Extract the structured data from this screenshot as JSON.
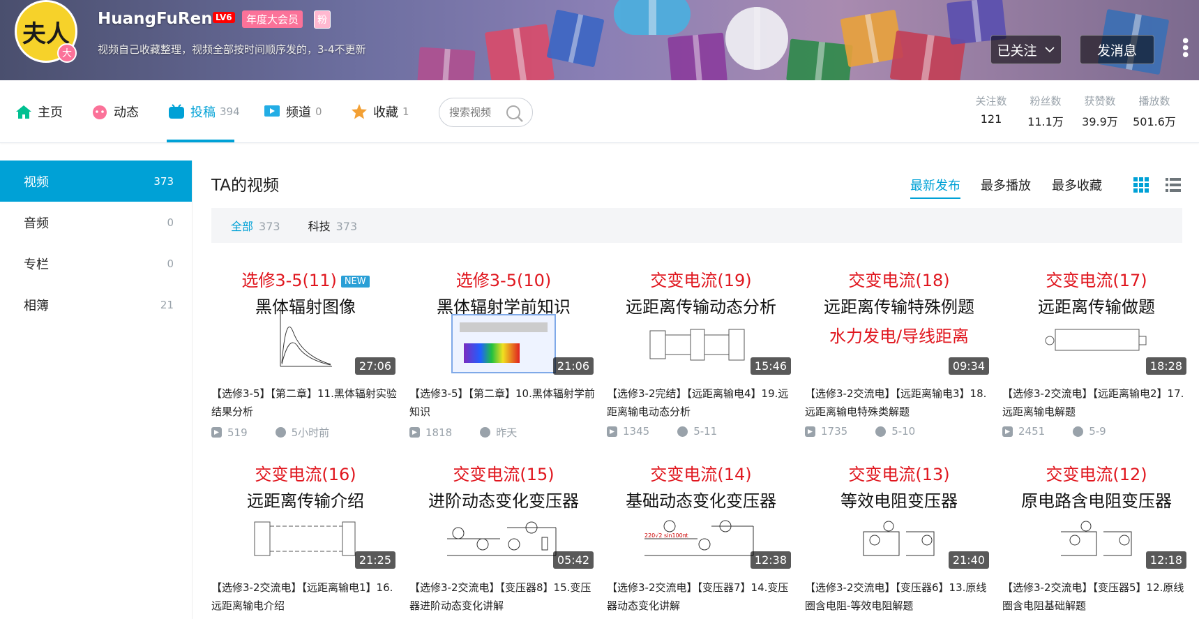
{
  "user": {
    "avatar_text": "夫人",
    "avatar_badge": "大",
    "name": "HuangFuRen",
    "level": "LV6",
    "vip": "年度大会员",
    "fan_badge": "粉",
    "sign": "视频自己收藏整理，视频全部按时间顺序发的，3-4不更新",
    "follow_btn": "已关注",
    "msg_btn": "发消息"
  },
  "nav": {
    "home": "主页",
    "dynamic": "动态",
    "tougao": "投稿",
    "tougao_count": "394",
    "channel": "频道",
    "channel_count": "0",
    "fav": "收藏",
    "fav_count": "1",
    "search_placeholder": "搜索视频"
  },
  "stats": [
    {
      "label": "关注数",
      "value": "121"
    },
    {
      "label": "粉丝数",
      "value": "11.1万"
    },
    {
      "label": "获赞数",
      "value": "39.9万"
    },
    {
      "label": "播放数",
      "value": "501.6万"
    }
  ],
  "sidebar": [
    {
      "label": "视频",
      "count": "373"
    },
    {
      "label": "音频",
      "count": "0"
    },
    {
      "label": "专栏",
      "count": "0"
    },
    {
      "label": "相簿",
      "count": "21"
    }
  ],
  "main": {
    "title": "TA的视频",
    "sort_new": "最新发布",
    "sort_play": "最多播放",
    "sort_fav": "最多收藏",
    "filter_all": "全部",
    "filter_all_count": "373",
    "filter_tech": "科技",
    "filter_tech_count": "373"
  },
  "videos": [
    {
      "t1": "选修3-5(11)",
      "new": "NEW",
      "t2": "黑体辐射图像",
      "t3": "",
      "dur": "27:06",
      "title": "【选修3-5】【第二章】11.黑体辐射实验结果分析",
      "plays": "519",
      "time": "5小时前"
    },
    {
      "t1": "选修3-5(10)",
      "new": "",
      "t2": "黑体辐射学前知识",
      "t3": "",
      "dur": "21:06",
      "title": "【选修3-5】【第二章】10.黑体辐射学前知识",
      "plays": "1818",
      "time": "昨天"
    },
    {
      "t1": "交变电流(19)",
      "new": "",
      "t2": "远距离传输动态分析",
      "t3": "",
      "dur": "15:46",
      "title": "【选修3-2完结】【远距离输电4】19.远距离输电动态分析",
      "plays": "1345",
      "time": "5-11"
    },
    {
      "t1": "交变电流(18)",
      "new": "",
      "t2": "远距离传输特殊例题",
      "t3": "水力发电/导线距离",
      "dur": "09:34",
      "title": "【选修3-2交流电】【远距离输电3】18.远距离输电特殊类解题",
      "plays": "1735",
      "time": "5-10"
    },
    {
      "t1": "交变电流(17)",
      "new": "",
      "t2": "远距离传输做题",
      "t3": "",
      "dur": "18:28",
      "title": "【选修3-2交流电】【远距离输电2】17.远距离输电解题",
      "plays": "2451",
      "time": "5-9"
    },
    {
      "t1": "交变电流(16)",
      "new": "",
      "t2": "远距离传输介绍",
      "t3": "",
      "dur": "21:25",
      "title": "【选修3-2交流电】【远距离输电1】16.远距离输电介绍",
      "plays": "",
      "time": ""
    },
    {
      "t1": "交变电流(15)",
      "new": "",
      "t2": "进阶动态变化变压器",
      "t3": "",
      "dur": "05:42",
      "title": "【选修3-2交流电】【变压器8】15.变压器进阶动态变化讲解",
      "plays": "",
      "time": ""
    },
    {
      "t1": "交变电流(14)",
      "new": "",
      "t2": "基础动态变化变压器",
      "t3": "",
      "dur": "12:38",
      "title": "【选修3-2交流电】【变压器7】14.变压器动态变化讲解",
      "plays": "",
      "time": ""
    },
    {
      "t1": "交变电流(13)",
      "new": "",
      "t2": "等效电阻变压器",
      "t3": "",
      "dur": "21:40",
      "title": "【选修3-2交流电】【变压器6】13.原线圈含电阻-等效电阻解题",
      "plays": "",
      "time": ""
    },
    {
      "t1": "交变电流(12)",
      "new": "",
      "t2": "原电路含电阻变压器",
      "t3": "",
      "dur": "12:18",
      "title": "【选修3-2交流电】【变压器5】12.原线圈含电阻基础解题",
      "plays": "",
      "time": ""
    }
  ]
}
